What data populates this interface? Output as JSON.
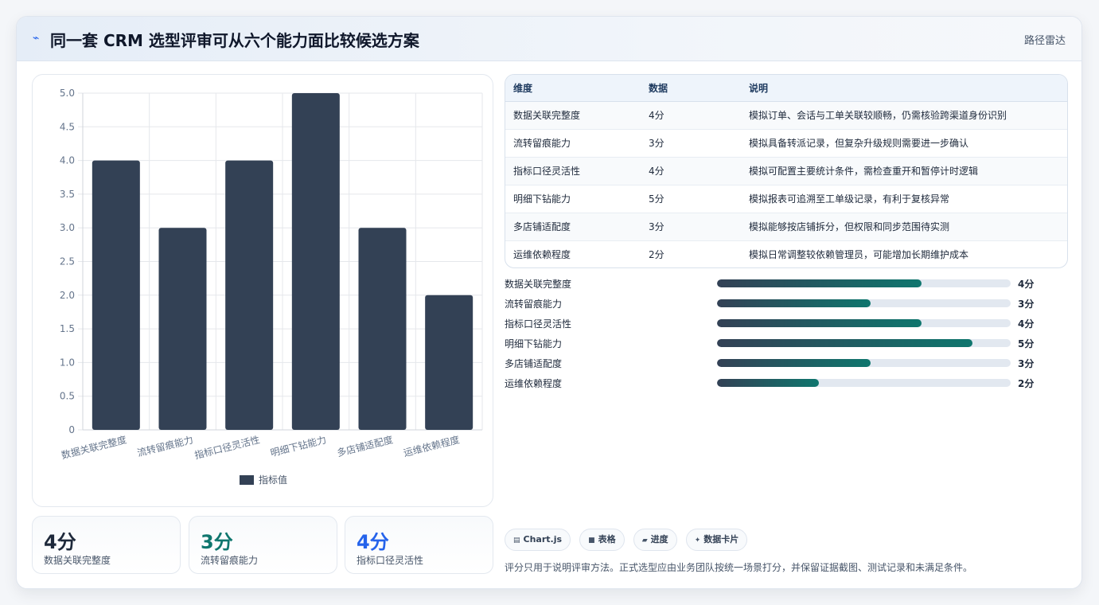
{
  "header": {
    "icon": "pulse-icon",
    "title": "同一套 CRM 选型评审可从六个能力面比较候选方案",
    "tag": "路径雷达"
  },
  "chart_data": {
    "type": "bar",
    "categories": [
      "数据关联完整度",
      "流转留痕能力",
      "指标口径灵活性",
      "明细下钻能力",
      "多店铺适配度",
      "运维依赖程度"
    ],
    "series": [
      {
        "name": "指标值",
        "values": [
          4,
          3,
          4,
          5,
          3,
          2
        ]
      }
    ],
    "ylim": [
      0,
      5
    ],
    "yticks": [
      "0",
      "0.5",
      "1.0",
      "1.5",
      "2.0",
      "2.5",
      "3.0",
      "3.5",
      "4.0",
      "4.5",
      "5.0"
    ],
    "grid": true,
    "legend": "bottom",
    "bar_color": "#334155"
  },
  "stats": [
    {
      "value": "4分",
      "label": "数据关联完整度",
      "color": "#1e293b"
    },
    {
      "value": "3分",
      "label": "流转留痕能力",
      "color": "#0f766e"
    },
    {
      "value": "4分",
      "label": "指标口径灵活性",
      "color": "#2563eb"
    }
  ],
  "table": {
    "headers": [
      "维度",
      "数据",
      "说明"
    ],
    "rows": [
      [
        "数据关联完整度",
        "4分",
        "模拟订单、会话与工单关联较顺畅，仍需核验跨渠道身份识别"
      ],
      [
        "流转留痕能力",
        "3分",
        "模拟具备转派记录，但复杂升级规则需要进一步确认"
      ],
      [
        "指标口径灵活性",
        "4分",
        "模拟可配置主要统计条件，需检查重开和暂停计时逻辑"
      ],
      [
        "明细下钻能力",
        "5分",
        "模拟报表可追溯至工单级记录，有利于复核异常"
      ],
      [
        "多店铺适配度",
        "3分",
        "模拟能够按店铺拆分，但权限和同步范围待实测"
      ],
      [
        "运维依赖程度",
        "2分",
        "模拟日常调整较依赖管理员，可能增加长期维护成本"
      ]
    ]
  },
  "progress": {
    "max": 5,
    "items": [
      {
        "label": "数据关联完整度",
        "value": 4,
        "text": "4分"
      },
      {
        "label": "流转留痕能力",
        "value": 3,
        "text": "3分"
      },
      {
        "label": "指标口径灵活性",
        "value": 4,
        "text": "4分"
      },
      {
        "label": "明细下钻能力",
        "value": 5,
        "text": "5分"
      },
      {
        "label": "多店铺适配度",
        "value": 3,
        "text": "3分"
      },
      {
        "label": "运维依赖程度",
        "value": 2,
        "text": "2分"
      }
    ]
  },
  "chips": [
    {
      "icon": "chart-icon",
      "glyph": "▤",
      "label": "Chart.js"
    },
    {
      "icon": "table-icon",
      "glyph": "■",
      "label": "表格"
    },
    {
      "icon": "progress-icon",
      "glyph": "▰",
      "label": "进度"
    },
    {
      "icon": "sparkle-icon",
      "glyph": "✦",
      "label": "数据卡片"
    }
  ],
  "footnote": "评分只用于说明评审方法。正式选型应由业务团队按统一场景打分，并保留证据截图、测试记录和未满足条件。"
}
